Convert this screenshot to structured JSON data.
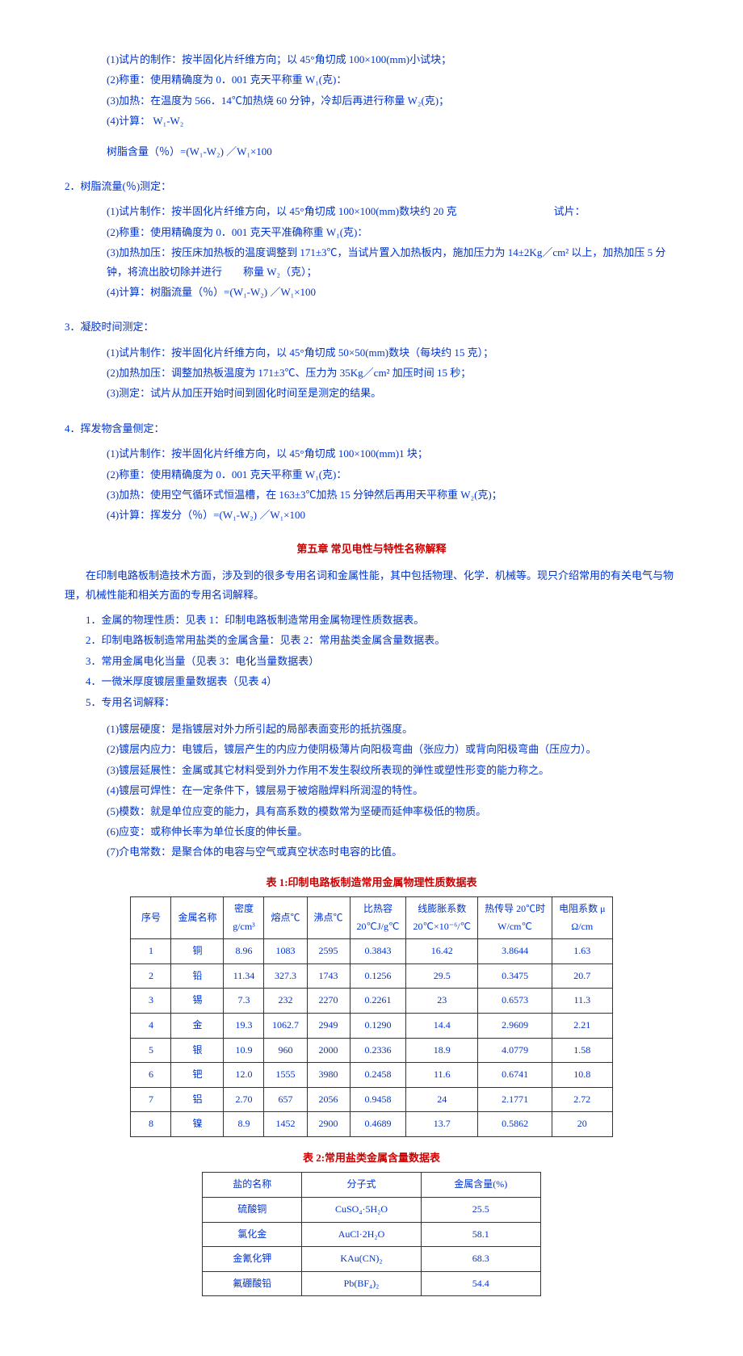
{
  "s1": {
    "p1": "(1)试片的制作：按半固化片纤维方向；以 45°角切成 100×100(mm)小试块；",
    "p2": "(2)称重：使用精确度为 0．001 克天平称重 W₁(克)：",
    "p3": "(3)加热：在温度为 566．14℃加热烧 60 分钟，冷却后再进行称量 W₂(克)；",
    "p4": "(4)计算： W₁-W₂",
    "p5": "树脂含量（％）=(W₁-W₂) ／W₁×100"
  },
  "s2": {
    "title": "2．树脂流量(％)测定：",
    "p1a": "(1)试片制作：按半固化片纤维方向，以 45°角切成 100×100(mm)数块约 20 克",
    "p1b": "试片：",
    "p2": "(2)称重：使用精确度为 0．001 克天平准确称重 W₁(克)：",
    "p3": "(3)加热加压：按压床加热板的温度调整到 171±3℃，当试片置入加热板内，施加压力为 14±2Kg／cm² 以上，加热加压 5 分钟，将流出胶切除并进行　　称量 W₂（克）；",
    "p4": "(4)计算：树脂流量（％）=(W₁-W₂) ／W₁×100"
  },
  "s3": {
    "title": "3．凝胶时间测定：",
    "p1": "(1)试片制作：按半固化片纤维方向，以 45°角切成 50×50(mm)数块（每块约 15 克）；",
    "p2": "(2)加热加压：调整加热板温度为 171±3℃、压力为 35Kg／cm² 加压时间 15 秒；",
    "p3": "(3)测定：试片从加压开始时间到固化时间至是测定的结果。"
  },
  "s4": {
    "title": "4．挥发物含量侧定：",
    "p1": "(1)试片制作：按半固化片纤维方向，以 45°角切成 100×100(mm)1 块；",
    "p2": "(2)称重：使用精确度为 0．001 克天平称重 W₁(克)：",
    "p3": "(3)加热：使用空气循环式恒温槽，在 163±3℃加热 15 分钟然后再用天平称重 W₂(克)；",
    "p4": "(4)计算：挥发分（％）=(W₁-W₂) ／W₁×100"
  },
  "ch5": {
    "title": "第五章 常见电性与特性名称解释",
    "intro": "在印制电路板制造技术方面，涉及到的很多专用名词和金属性能，其中包括物理、化学．机械等。现只介绍常用的有关电气与物理，机械性能和相关方面的专用名词解释。",
    "l1": "1．金属的物理性质：见表 1：印制电路板制造常用金属物理性质数据表。",
    "l2": "2．印制电路板制造常用盐类的金属含量：见表 2：常用盐类金属含量数据表。",
    "l3": "3．常用金属电化当量（见表 3：电化当量数据表）",
    "l4": "4．一微米厚度镀层重量数据表（见表 4）",
    "l5": "5．专用名词解释：",
    "d1": "(1)镀层硬度：是指镀层对外力所引起的局部表面变形的抵抗强度。",
    "d2": "(2)镀层内应力：电镀后，镀层产生的内应力使阴极薄片向阳极弯曲（张应力）或背向阳极弯曲（压应力）。",
    "d3": "(3)镀层延展性：金属或其它材料受到外力作用不发生裂纹所表现的弹性或塑性形变的能力称之。",
    "d4": "(4)镀层可焊性：在一定条件下，镀层易于被熔融焊料所润湿的特性。",
    "d5": "(5)模数：就是单位应变的能力，具有高系数的模数常为坚硬而延伸率极低的物质。",
    "d6": "(6)应变：或称伸长率为单位长度的伸长量。",
    "d7": "(7)介电常数：是聚合体的电容与空气或真空状态时电容的比值。"
  },
  "table1": {
    "title": "表 1:印制电路板制造常用金属物理性质数据表",
    "headers": [
      "序号",
      "金属名称",
      "密度\ng/cm³",
      "熔点℃",
      "沸点℃",
      "比热容\n20℃J/g℃",
      "线膨胀系数\n20℃×10⁻⁶/℃",
      "热传导 20℃时\nW/cm℃",
      "电阻系数 μ\nΩ/cm"
    ],
    "rows": [
      [
        "1",
        "铜",
        "8.96",
        "1083",
        "2595",
        "0.3843",
        "16.42",
        "3.8644",
        "1.63"
      ],
      [
        "2",
        "铅",
        "11.34",
        "327.3",
        "1743",
        "0.1256",
        "29.5",
        "0.3475",
        "20.7"
      ],
      [
        "3",
        "锡",
        "7.3",
        "232",
        "2270",
        "0.2261",
        "23",
        "0.6573",
        "11.3"
      ],
      [
        "4",
        "金",
        "19.3",
        "1062.7",
        "2949",
        "0.1290",
        "14.4",
        "2.9609",
        "2.21"
      ],
      [
        "5",
        "银",
        "10.9",
        "960",
        "2000",
        "0.2336",
        "18.9",
        "4.0779",
        "1.58"
      ],
      [
        "6",
        "钯",
        "12.0",
        "1555",
        "3980",
        "0.2458",
        "11.6",
        "0.6741",
        "10.8"
      ],
      [
        "7",
        "铝",
        "2.70",
        "657",
        "2056",
        "0.9458",
        "24",
        "2.1771",
        "2.72"
      ],
      [
        "8",
        "镍",
        "8.9",
        "1452",
        "2900",
        "0.4689",
        "13.7",
        "0.5862",
        "20"
      ]
    ]
  },
  "table2": {
    "title": "表 2:常用盐类金属含量数据表",
    "headers": [
      "盐的名称",
      "分子式",
      "金属含量(%)"
    ],
    "rows": [
      [
        "硫酸铜",
        "CuSO₄·5H₂O",
        "25.5"
      ],
      [
        "氯化金",
        "AuCl·2H₂O",
        "58.1"
      ],
      [
        "金氰化钾",
        "KAu(CN)₂",
        "68.3"
      ],
      [
        "氟硼酸铅",
        "Pb(BF₄)₂",
        "54.4"
      ]
    ]
  }
}
